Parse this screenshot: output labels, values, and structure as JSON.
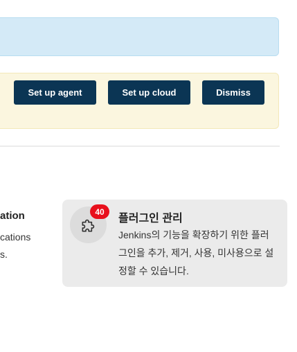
{
  "banners": {
    "info": {},
    "agent_setup": {
      "buttons": {
        "setup_agent": "Set up agent",
        "setup_cloud": "Set up cloud",
        "dismiss": "Dismiss"
      }
    }
  },
  "left_card": {
    "title": "ation",
    "description": "cations\ns."
  },
  "plugin_card": {
    "icon": "puzzle-icon",
    "badge": "40",
    "title": "플러그인 관리",
    "description": "Jenkins의 기능을 확장하기 위한 플러그인을 추가, 제거, 사용, 미사용으로 설정할 수 있습니다."
  },
  "colors": {
    "info_banner_bg": "#d4eaf7",
    "warn_banner_bg": "#fbf6df",
    "button_bg": "#0b3554",
    "badge_bg": "#e8101c",
    "card_bg": "#ebebeb"
  }
}
